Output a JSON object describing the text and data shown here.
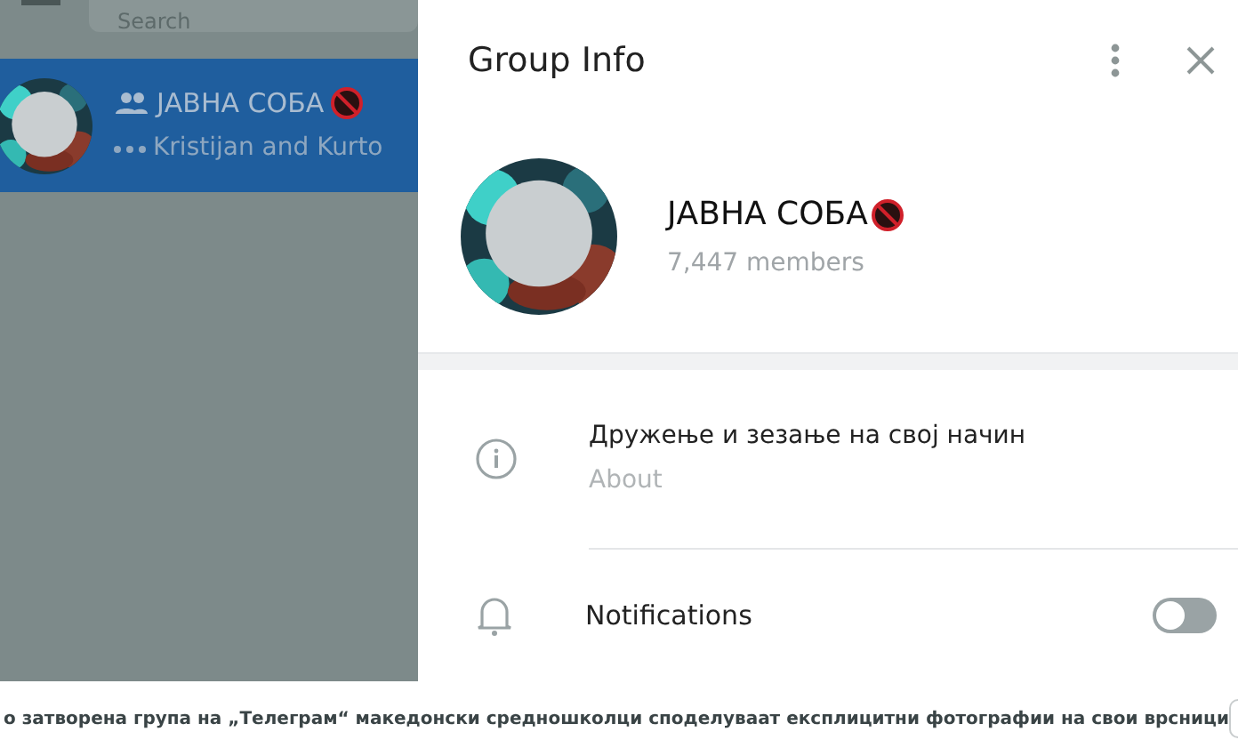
{
  "sidebar": {
    "search": {
      "placeholder": "Search"
    },
    "chats": [
      {
        "name": "ЈАВНА СОБА",
        "typing": "Kristijan and Kurto",
        "selected": true
      }
    ]
  },
  "group_info": {
    "title": "Group Info",
    "name": "ЈАВНА СОБА",
    "members": "7,447 members",
    "about": {
      "text": "Дружење и зезање на свој начин",
      "label": "About"
    },
    "notifications": {
      "label": "Notifications",
      "on": false
    }
  },
  "caption": "о затворена група на „Телеграм“ македонски средношколци споделуваат експлицитни фотографии на свои врсници"
}
